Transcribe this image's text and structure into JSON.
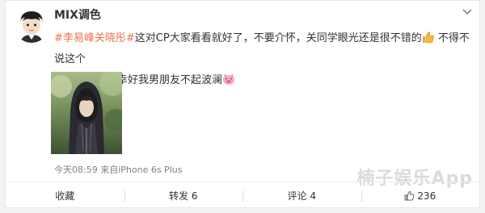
{
  "post": {
    "username": "MIX调色",
    "topic": "#李易峰关晓彤#",
    "text_line1": "这对CP大家看看就好了，不要介怀，关同学眼光还是很不错的",
    "text_line1b": " 不得不说这个",
    "text_line2": "情敌太强大，幸好我男朋友不起波澜",
    "time": "今天08:59",
    "source_prefix": "来自",
    "source": "iPhone 6s Plus"
  },
  "actions": {
    "favorite": "收藏",
    "repost": "转发 6",
    "comment": "评论 4",
    "like": "236"
  },
  "watermark": "楠子娱乐App",
  "icons": {
    "caret": "chevron-down-icon",
    "like": "thumbs-up-icon",
    "emoji1": "thumbs-up-emoji",
    "emoji2": "pig-emoji"
  }
}
